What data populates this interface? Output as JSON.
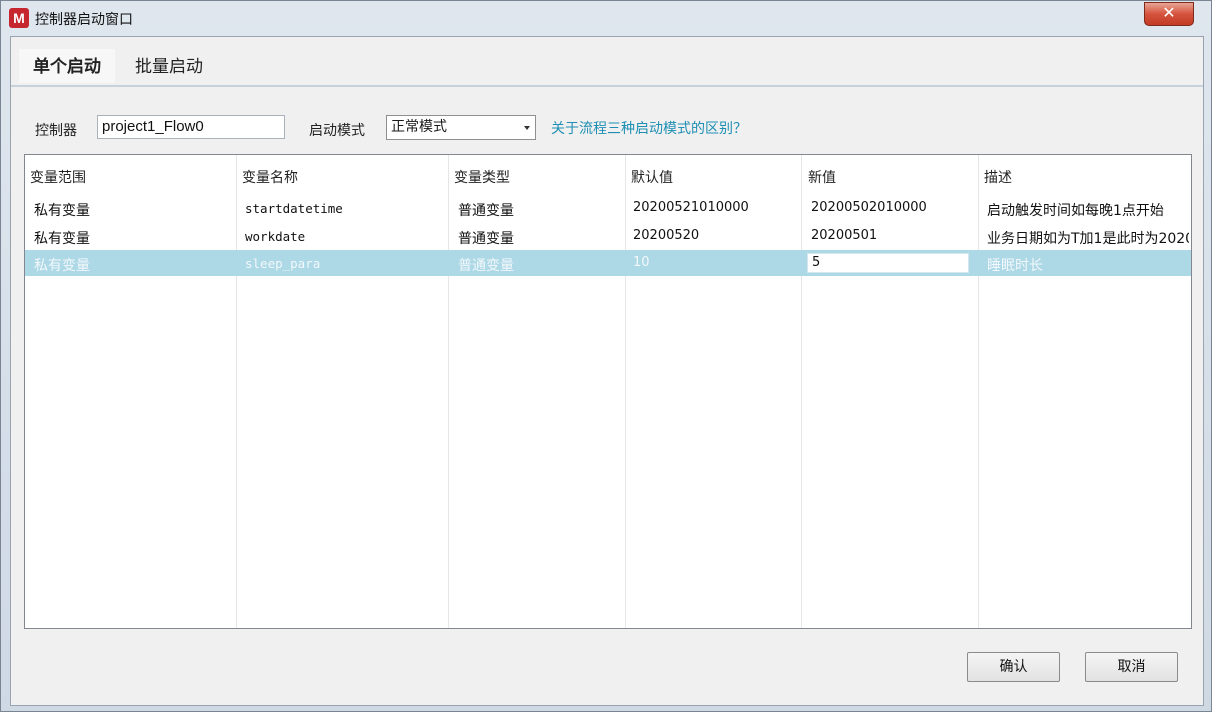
{
  "window": {
    "title": "控制器启动窗口",
    "icon_letter": "M",
    "close_glyph": "✕"
  },
  "tabs": [
    {
      "label": "单个启动",
      "active": true
    },
    {
      "label": "批量启动",
      "active": false
    }
  ],
  "form": {
    "controller_label": "控制器",
    "controller_value": "project1_Flow0",
    "mode_label": "启动模式",
    "mode_value": "正常模式",
    "help_link": "关于流程三种启动模式的区别？"
  },
  "table": {
    "columns": [
      "变量范围",
      "变量名称",
      "变量类型",
      "默认值",
      "新值",
      "描述"
    ],
    "rows": [
      {
        "scope": "私有变量",
        "name": "startdatetime",
        "type": "普通变量",
        "default": "20200521010000",
        "new": "20200502010000",
        "desc": "启动触发时间如每晚1点开始"
      },
      {
        "scope": "私有变量",
        "name": "workdate",
        "type": "普通变量",
        "default": "20200520",
        "new": "20200501",
        "desc": "业务日期如为T加1是此时为2020"
      },
      {
        "scope": "私有变量",
        "name": "sleep_para",
        "type": "普通变量",
        "default": "10",
        "new": "5",
        "desc": "睡眠时长",
        "selected": true
      }
    ]
  },
  "buttons": {
    "ok": "确认",
    "cancel": "取消"
  },
  "colors": {
    "selection": "#add8e6",
    "link": "#1e8fb3",
    "close": "#c23b24"
  }
}
